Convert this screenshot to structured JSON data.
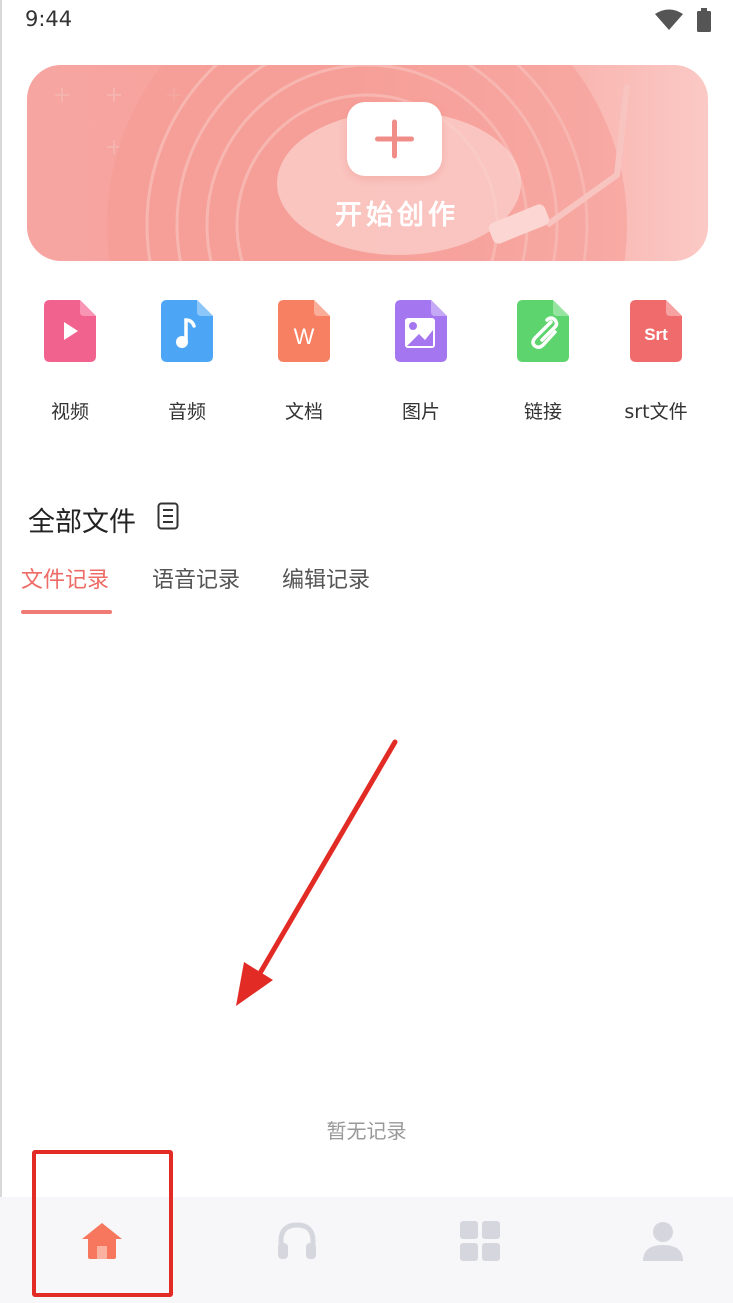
{
  "status_bar": {
    "time": "9:44",
    "icons": [
      "wifi-icon",
      "battery-icon"
    ]
  },
  "banner": {
    "label": "开始创作",
    "icon": "plus-icon"
  },
  "tools": [
    {
      "name": "tool-video",
      "label": "视频",
      "icon": "video-file-icon",
      "color": "#f2628e"
    },
    {
      "name": "tool-audio",
      "label": "音频",
      "icon": "audio-file-icon",
      "color": "#4da6f5"
    },
    {
      "name": "tool-document",
      "label": "文档",
      "icon": "word-file-icon",
      "glyph": "W",
      "color": "#f77f62"
    },
    {
      "name": "tool-image",
      "label": "图片",
      "icon": "image-file-icon",
      "color": "#a477f0"
    },
    {
      "name": "tool-link",
      "label": "链接",
      "icon": "link-file-icon",
      "color": "#5dd46d"
    },
    {
      "name": "tool-srt",
      "label": "srt文件",
      "icon": "srt-file-icon",
      "glyph": "Srt",
      "color": "#f06c6c"
    }
  ],
  "files_section": {
    "title": "全部文件",
    "icon": "list-icon"
  },
  "tabs": [
    {
      "label": "文件记录",
      "active": true
    },
    {
      "label": "语音记录",
      "active": false
    },
    {
      "label": "编辑记录",
      "active": false
    }
  ],
  "empty_state": {
    "text": "暂无记录"
  },
  "bottom_nav": [
    {
      "name": "home",
      "icon": "home-icon",
      "active": true
    },
    {
      "name": "listen",
      "icon": "headphones-icon",
      "active": false
    },
    {
      "name": "apps",
      "icon": "grid-icon",
      "active": false
    },
    {
      "name": "profile",
      "icon": "user-icon",
      "active": false
    }
  ],
  "colors": {
    "accent": "#ee6b66",
    "annotation": "#e32b25",
    "banner": "#f7a5a0"
  }
}
